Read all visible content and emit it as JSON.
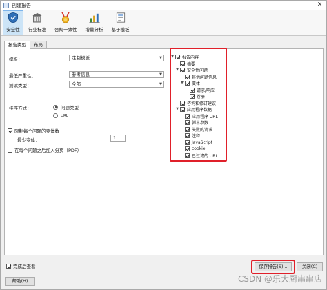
{
  "window": {
    "title": "创建报告"
  },
  "toolbar": {
    "items": [
      {
        "label": "安全性",
        "icon": "shield-icon"
      },
      {
        "label": "行业标准",
        "icon": "building-icon"
      },
      {
        "label": "合规一致性",
        "icon": "medal-icon"
      },
      {
        "label": "增量分析",
        "icon": "chart-icon"
      },
      {
        "label": "基于模板",
        "icon": "template-icon"
      }
    ]
  },
  "tabs": [
    "报告类型",
    "布局"
  ],
  "form": {
    "template_label": "模板：",
    "template_value": "定制模板",
    "severity_label": "最低严重性：",
    "severity_value": "参考信息",
    "test_type_label": "测试类型：",
    "test_type_value": "全部",
    "sort_label": "排序方式：",
    "sort_option1": "问题类型",
    "sort_option2": "URL",
    "limit_label": "限制每个问题的变体数",
    "min_variants_label": "最少变体：",
    "min_variants_value": "1",
    "page_break_label": "在每个问题之后加入分页（PDF）"
  },
  "tree": {
    "root": "报告内容",
    "summary": "摘要",
    "security_issues": "安全性问题",
    "other_info": "其他问题信息",
    "variants": "变体",
    "request_response": "请求/响应",
    "cve": "卷册",
    "advisories": "咨询和修订建议",
    "app_data": "应用程序数据",
    "app_urls": "应用程序 URL",
    "script_params": "脚本参数",
    "failed_requests": "失败的请求",
    "comments": "注释",
    "javascript": "JavaScript",
    "cookie": "cookie",
    "filtered_urls": "已过滤的 URL"
  },
  "footer": {
    "open_after": "完成后查看",
    "help": "帮助(H)",
    "save": "保存报告(S)...",
    "close": "关闭(C)"
  },
  "watermark": "CSDN @乐大厨串串店",
  "colors": {
    "highlight": "#e0202a",
    "active_tool": "#cce4f7"
  }
}
